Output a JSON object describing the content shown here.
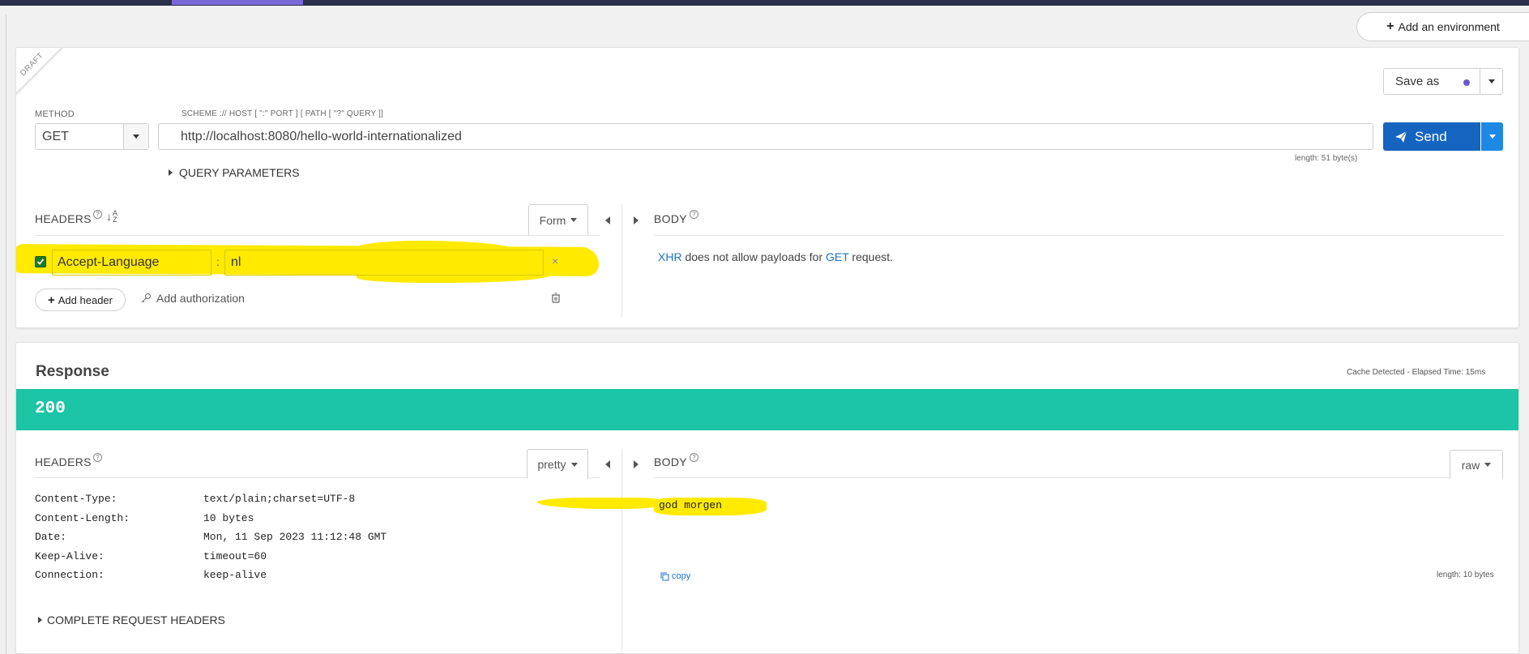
{
  "environment": {
    "add_label": "Add an environment"
  },
  "request": {
    "draft_label": "DRAFT",
    "save_as_label": "Save as",
    "method_label": "METHOD",
    "method_value": "GET",
    "url_label": "SCHEME :// HOST [ \":\" PORT ] [ PATH [ \"?\" QUERY ]]",
    "url_value": "http://localhost:8080/hello-world-internationalized",
    "url_length": "length: 51 byte(s)",
    "send_label": "Send",
    "query_params_label": "QUERY PARAMETERS",
    "headers_title": "HEADERS",
    "headers_mode": "Form",
    "header_key": "Accept-Language",
    "header_value": "nl",
    "header_separator": ":",
    "add_header_label": "Add header",
    "add_auth_label": "Add authorization",
    "body_title": "BODY",
    "body_note_xhr": "XHR",
    "body_note_mid": " does not allow payloads for ",
    "body_note_get": "GET",
    "body_note_end": " request."
  },
  "response": {
    "title": "Response",
    "meta": "Cache Detected - Elapsed Time: 15ms",
    "status_code": "200",
    "headers_title": "HEADERS",
    "headers_mode": "pretty",
    "headers": [
      {
        "key": "Content-Type:",
        "value": "text/plain;charset=UTF-8"
      },
      {
        "key": "Content-Length:",
        "value": "10 bytes"
      },
      {
        "key": "Date:",
        "value": "Mon, 11 Sep 2023 11:12:48 GMT"
      },
      {
        "key": "Keep-Alive:",
        "value": "timeout=60"
      },
      {
        "key": "Connection:",
        "value": "keep-alive"
      }
    ],
    "complete_headers_label": "COMPLETE REQUEST HEADERS",
    "body_title": "BODY",
    "body_mode": "raw",
    "body_text": "god morgen",
    "copy_label": "copy",
    "body_length": "length: 10 bytes"
  },
  "colors": {
    "accent": "#7b68d8",
    "send": "#1565c0",
    "status_bar": "#1bc5a6",
    "highlight": "#ffea00",
    "link": "#1a73c8"
  }
}
